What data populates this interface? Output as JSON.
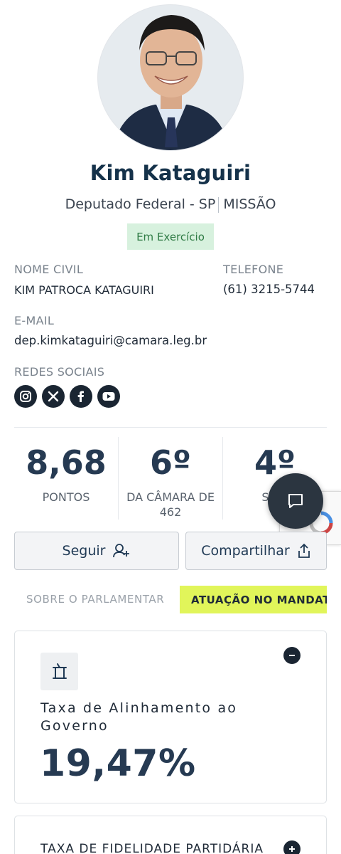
{
  "profile": {
    "name": "Kim Kataguiri",
    "role": "Deputado Federal - SP",
    "party": "MISSÃO",
    "status": "Em Exercício"
  },
  "info": {
    "civil_name_label": "NOME CIVIL",
    "civil_name": "KIM PATROCA KATAGUIRI",
    "phone_label": "TELEFONE",
    "phone": "(61) 3215-5744",
    "email_label": "E-MAIL",
    "email": "dep.kimkataguiri@camara.leg.br",
    "social_label": "REDES SOCIAIS",
    "social_icons": [
      "instagram-icon",
      "x-icon",
      "facebook-icon",
      "youtube-icon"
    ]
  },
  "stats": [
    {
      "value": "8,68",
      "label": "PONTOS"
    },
    {
      "value": "6º",
      "label": "DA CÂMARA DE",
      "label2": "462"
    },
    {
      "value": "4º",
      "label": "SP D"
    }
  ],
  "actions": {
    "follow": "Seguir",
    "share": "Compartilhar"
  },
  "tabs": {
    "about": "SOBRE O PARLAMENTAR",
    "performance": "ATUAÇÃO NO MANDATO"
  },
  "cards": [
    {
      "title": "Taxa de Alinhamento ao Governo",
      "value": "19,47%",
      "expanded": true
    },
    {
      "title": "TAXA DE FIDELIDADE PARTIDÁRIA",
      "expanded": false
    }
  ],
  "colors": {
    "primary": "#263a52",
    "highlight": "#e1f55a",
    "status_bg": "#d7f1de",
    "status_text": "#2e7a44"
  }
}
